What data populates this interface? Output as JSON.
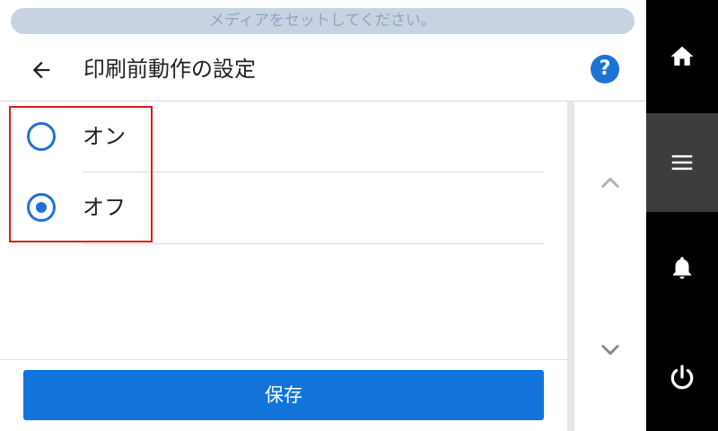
{
  "status": {
    "message": "メディアをセットしてください。"
  },
  "header": {
    "title": "印刷前動作の設定",
    "help_label": "?"
  },
  "options": [
    {
      "label": "オン",
      "selected": false
    },
    {
      "label": "オフ",
      "selected": true
    }
  ],
  "footer": {
    "save_label": "保存"
  },
  "icons": {
    "back": "back-arrow-icon",
    "help": "help-icon",
    "scroll_up": "chevron-up-icon",
    "scroll_down": "chevron-down-icon",
    "home": "home-icon",
    "menu": "menu-icon",
    "notifications": "bell-icon",
    "power": "power-icon"
  },
  "colors": {
    "accent": "#1b73d6",
    "highlight": "#e01a1a",
    "sidebar": "#000000",
    "sidebar_active": "#3d3d3d"
  }
}
